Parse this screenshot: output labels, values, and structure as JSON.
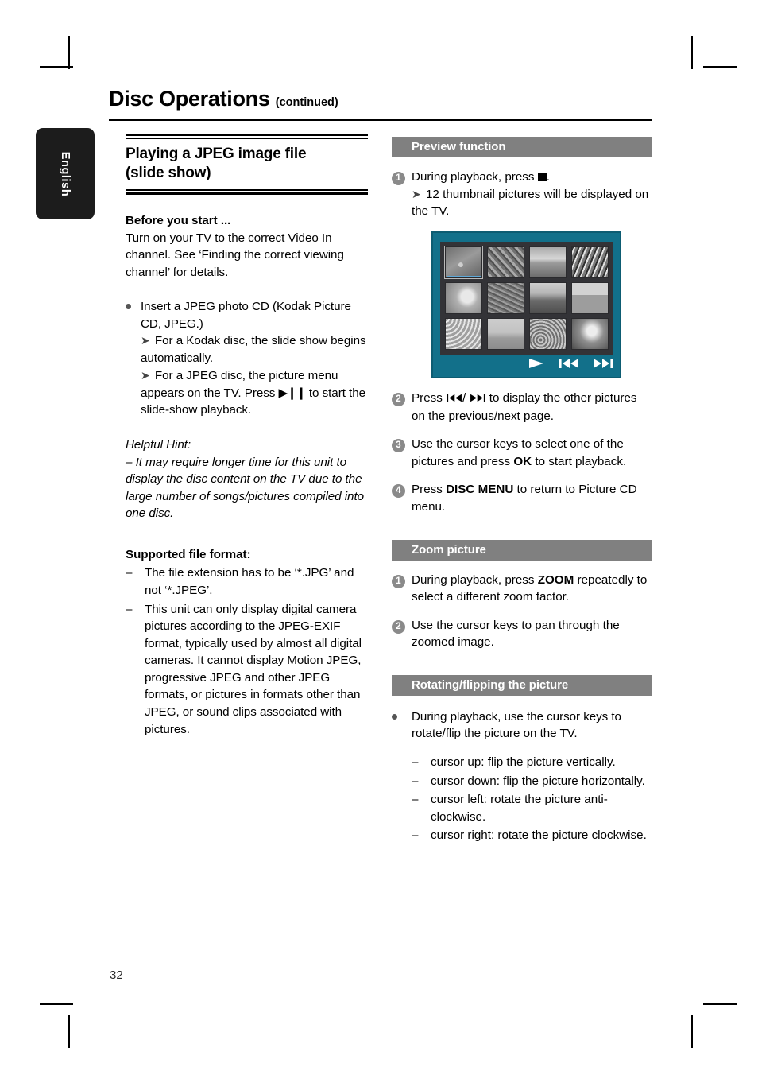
{
  "page": {
    "number": "32",
    "language_tab": "English"
  },
  "header": {
    "title": "Disc Operations",
    "continued": "(continued)"
  },
  "left_column": {
    "section_title_line1": "Playing a JPEG image file",
    "section_title_line2": "(slide show)",
    "before_you_start": {
      "heading": "Before you start ...",
      "text": "Turn on your TV to the correct Video In channel.  See ‘Finding the correct viewing channel’ for details."
    },
    "insert_bullet": {
      "text": "Insert a JPEG photo CD (Kodak Picture CD, JPEG.)",
      "arrow1": "For a Kodak disc, the slide show begins automatically.",
      "arrow2_prefix": "For a JPEG disc, the picture menu appears on the TV.  Press",
      "arrow2_suffix": "to start the slide-show playback.",
      "arrow2_icon": "play-pause-icon"
    },
    "helpful_hint": {
      "heading": "Helpful Hint:",
      "dash": "–",
      "text": "It may require longer time for this unit to display the disc content on the TV due to the large number of songs/pictures compiled into one disc."
    },
    "supported_format": {
      "heading": "Supported file format:",
      "items": [
        "The file extension has to be ‘*.JPG’ and not ‘*.JPEG’.",
        "This unit can only display digital camera pictures according to the JPEG-EXIF format, typically used by almost all digital cameras.  It cannot display Motion JPEG, progressive JPEG and other JPEG formats, or pictures in formats other than JPEG, or sound clips associated with pictures."
      ]
    }
  },
  "right_column": {
    "preview_function": {
      "bar_label": "Preview function",
      "step1_prefix": "During playback, press",
      "step1_icon": "stop-icon",
      "step1_suffix": ".",
      "step1_arrow": "12 thumbnail pictures will be displayed on the TV.",
      "step2_prefix": "Press",
      "step2_icon_prev": "previous-icon",
      "step2_separator": "/",
      "step2_icon_next": "next-icon",
      "step2_suffix": "to display the other pictures on the previous/next page.",
      "step3_a": "Use the cursor keys to select one of the pictures and press",
      "step3_bold": "OK",
      "step3_b": "to start playback.",
      "step4_a": "Press",
      "step4_bold": "DISC MENU",
      "step4_b": "to return to Picture CD menu.",
      "numbers": [
        "1",
        "2",
        "3",
        "4"
      ]
    },
    "tv_preview": {
      "background_color": "#12708a",
      "panel_color": "#333337",
      "selection_color": "#5ea8d8",
      "thumbnail_count": 12,
      "selected_index": 0,
      "controls": [
        "play-icon",
        "previous-icon",
        "next-icon"
      ]
    },
    "zoom_picture": {
      "bar_label": "Zoom picture",
      "numbers": [
        "1",
        "2"
      ],
      "step1_a": "During playback, press",
      "step1_bold": "ZOOM",
      "step1_b": "repeatedly to select a different zoom factor.",
      "step2": "Use the cursor keys to pan through the zoomed image."
    },
    "rotating_flipping": {
      "bar_label": "Rotating/flipping the picture",
      "bullet": "During playback, use the cursor keys to rotate/flip the picture on the TV.",
      "dash": "–",
      "items": [
        "cursor up: flip the picture vertically.",
        "cursor down: flip the picture horizontally.",
        "cursor left: rotate the picture anti-clockwise.",
        "cursor right: rotate the picture clockwise."
      ]
    }
  }
}
